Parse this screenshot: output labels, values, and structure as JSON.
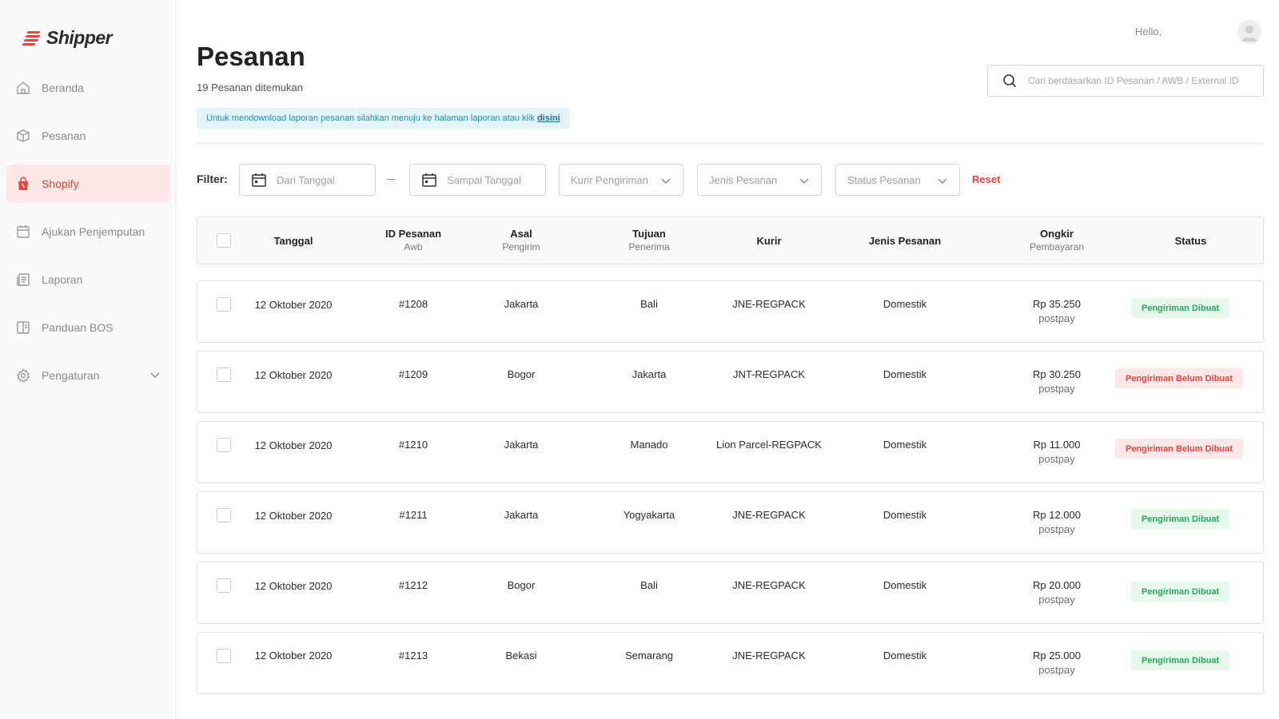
{
  "brand": {
    "name": "Shipper",
    "accent": "#e8453c"
  },
  "sidebar": {
    "items": [
      {
        "label": "Beranda",
        "icon": "home-icon",
        "active": false
      },
      {
        "label": "Pesanan",
        "icon": "box-icon",
        "active": false
      },
      {
        "label": "Shopify",
        "icon": "shopping-bag-icon",
        "active": true
      },
      {
        "label": "Ajukan Penjemputan",
        "icon": "calendar-icon",
        "active": false
      },
      {
        "label": "Laporan",
        "icon": "report-icon",
        "active": false
      },
      {
        "label": "Panduan BOS",
        "icon": "guide-icon",
        "active": false
      },
      {
        "label": "Pengaturan",
        "icon": "gear-icon",
        "active": false,
        "expandable": true
      }
    ]
  },
  "header": {
    "greeting": "Hello,",
    "title": "Pesanan",
    "result_count": "19 Pesanan ditemukan",
    "banner_text": "Untuk mendownload laporan pesanan silahkan menuju ke halaman laporan atau klik",
    "banner_link": "disini"
  },
  "search": {
    "placeholder": "Cari berdasarkan ID Pesanan / AWB / External ID",
    "value": ""
  },
  "filters": {
    "label": "Filter:",
    "from_date": "Dari Tanggal",
    "to_date": "Sampai Tanggal",
    "courier": "Kurir Pengiriman",
    "order_type": "Jenis Pesanan",
    "order_status": "Status Pesanan",
    "reset": "Reset"
  },
  "table": {
    "headers": {
      "date": "Tanggal",
      "order_id": "ID Pesanan",
      "order_id_sub": "Awb",
      "origin": "Asal",
      "origin_sub": "Pengirim",
      "destination": "Tujuan",
      "destination_sub": "Penerima",
      "courier": "Kurir",
      "order_type": "Jenis Pesanan",
      "cost": "Ongkir",
      "cost_sub": "Pembayaran",
      "status": "Status"
    },
    "rows": [
      {
        "date": "12 Oktober 2020",
        "id": "#1208",
        "origin": "Jakarta",
        "destination": "Bali",
        "courier": "JNE-REGPACK",
        "type": "Domestik",
        "cost": "Rp 35.250",
        "payment": "postpay",
        "status": "Pengiriman Dibuat",
        "status_ok": true
      },
      {
        "date": "12 Oktober 2020",
        "id": "#1209",
        "origin": "Bogor",
        "destination": "Jakarta",
        "courier": "JNT-REGPACK",
        "type": "Domestik",
        "cost": "Rp 30.250",
        "payment": "postpay",
        "status": "Pengiriman Belum Dibuat",
        "status_ok": false
      },
      {
        "date": "12 Oktober 2020",
        "id": "#1210",
        "origin": "Jakarta",
        "destination": "Manado",
        "courier": "Lion Parcel-REGPACK",
        "type": "Domestik",
        "cost": "Rp 11.000",
        "payment": "postpay",
        "status": "Pengiriman Belum Dibuat",
        "status_ok": false
      },
      {
        "date": "12 Oktober 2020",
        "id": "#1211",
        "origin": "Jakarta",
        "destination": "Yogyakarta",
        "courier": "JNE-REGPACK",
        "type": "Domestik",
        "cost": "Rp 12.000",
        "payment": "postpay",
        "status": "Pengiriman Dibuat",
        "status_ok": true
      },
      {
        "date": "12 Oktober 2020",
        "id": "#1212",
        "origin": "Bogor",
        "destination": "Bali",
        "courier": "JNE-REGPACK",
        "type": "Domestik",
        "cost": "Rp 20.000",
        "payment": "postpay",
        "status": "Pengiriman Dibuat",
        "status_ok": true
      },
      {
        "date": "12 Oktober 2020",
        "id": "#1213",
        "origin": "Bekasi",
        "destination": "Semarang",
        "courier": "JNE-REGPACK",
        "type": "Domestik",
        "cost": "Rp 25.000",
        "payment": "postpay",
        "status": "Pengiriman Dibuat",
        "status_ok": true
      }
    ]
  }
}
